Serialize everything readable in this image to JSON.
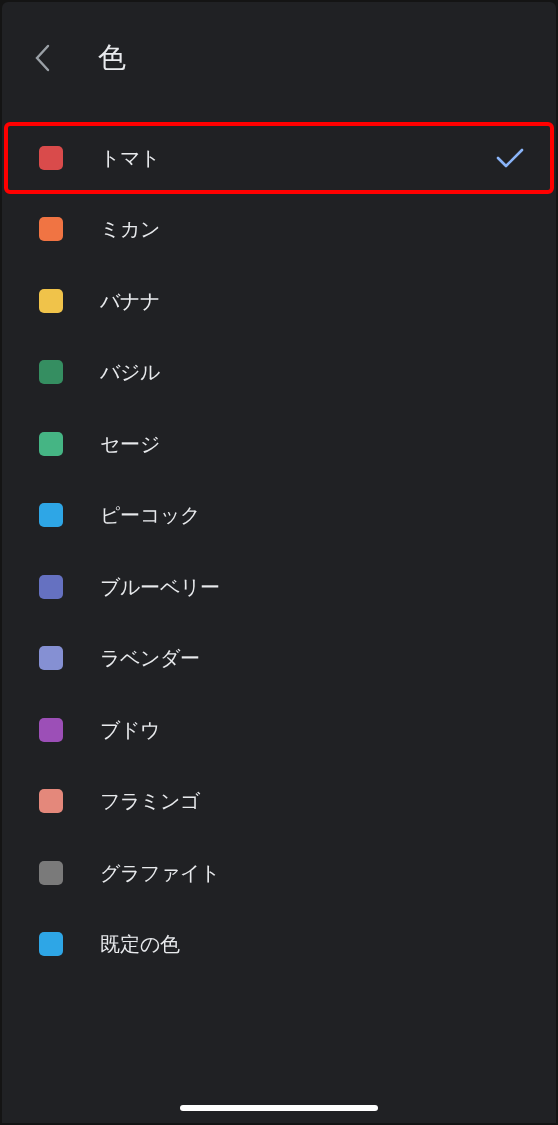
{
  "header": {
    "title": "色"
  },
  "colors": [
    {
      "label": "トマト",
      "color": "#d94b4b",
      "selected": true
    },
    {
      "label": "ミカン",
      "color": "#f07443",
      "selected": false
    },
    {
      "label": "バナナ",
      "color": "#f0c34a",
      "selected": false
    },
    {
      "label": "バジル",
      "color": "#358e61",
      "selected": false
    },
    {
      "label": "セージ",
      "color": "#45b584",
      "selected": false
    },
    {
      "label": "ピーコック",
      "color": "#2ea6e6",
      "selected": false
    },
    {
      "label": "ブルーベリー",
      "color": "#6571c1",
      "selected": false
    },
    {
      "label": "ラベンダー",
      "color": "#8590d3",
      "selected": false
    },
    {
      "label": "ブドウ",
      "color": "#9c4fb7",
      "selected": false
    },
    {
      "label": "フラミンゴ",
      "color": "#e4887b",
      "selected": false
    },
    {
      "label": "グラファイト",
      "color": "#7a7a7a",
      "selected": false
    },
    {
      "label": "既定の色",
      "color": "#2ea6e6",
      "selected": false
    }
  ]
}
